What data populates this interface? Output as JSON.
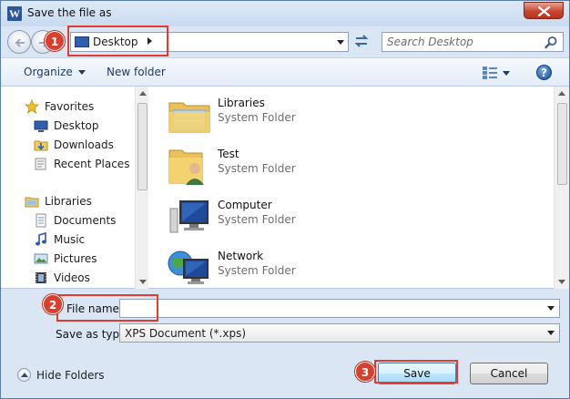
{
  "window": {
    "title": "Save the file as",
    "app_icon_letter": "W"
  },
  "address": {
    "location": "Desktop",
    "search_placeholder": "Search Desktop"
  },
  "toolbar": {
    "organize_label": "Organize",
    "new_folder_label": "New folder",
    "help_glyph": "?"
  },
  "nav_pane": {
    "items": [
      {
        "label": "Favorites",
        "icon": "star-icon",
        "level": 0
      },
      {
        "label": "Desktop",
        "icon": "desktop-icon",
        "level": 1
      },
      {
        "label": "Downloads",
        "icon": "downloads-icon",
        "level": 1
      },
      {
        "label": "Recent Places",
        "icon": "recent-places-icon",
        "level": 1
      },
      {
        "label": "Libraries",
        "icon": "libraries-icon",
        "level": 0
      },
      {
        "label": "Documents",
        "icon": "documents-icon",
        "level": 1
      },
      {
        "label": "Music",
        "icon": "music-icon",
        "level": 1
      },
      {
        "label": "Pictures",
        "icon": "pictures-icon",
        "level": 1
      },
      {
        "label": "Videos",
        "icon": "videos-icon",
        "level": 1
      }
    ]
  },
  "content": {
    "items": [
      {
        "name": "Libraries",
        "type": "System Folder",
        "icon": "libraries-folder-icon"
      },
      {
        "name": "Test",
        "type": "System Folder",
        "icon": "user-folder-icon"
      },
      {
        "name": "Computer",
        "type": "System Folder",
        "icon": "computer-icon"
      },
      {
        "name": "Network",
        "type": "System Folder",
        "icon": "network-icon"
      }
    ]
  },
  "fields": {
    "file_name_label": "File name:",
    "file_name_value": "",
    "save_as_type_label": "Save as type:",
    "save_as_type_value": "XPS Document (*.xps)"
  },
  "footer": {
    "hide_folders_label": "Hide Folders",
    "save_label": "Save",
    "cancel_label": "Cancel"
  },
  "callouts": [
    "1",
    "2",
    "3"
  ],
  "colors": {
    "callout_red": "#e03c31",
    "accent_blue": "#2b5797"
  }
}
